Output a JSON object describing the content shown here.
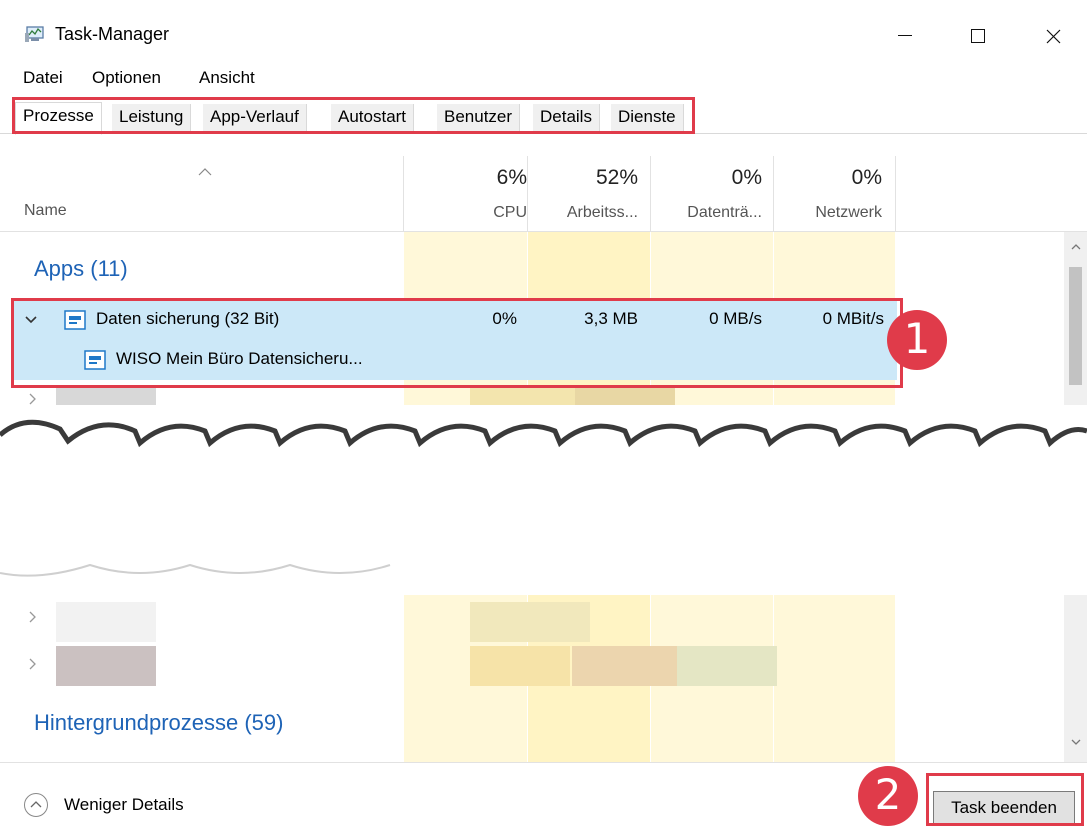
{
  "window": {
    "title": "Task-Manager",
    "minimize_glyph": "–",
    "maximize_glyph": "☐",
    "close_glyph": "✕"
  },
  "menu": {
    "items": [
      {
        "label": "Datei"
      },
      {
        "label": "Optionen"
      },
      {
        "label": "Ansicht"
      }
    ]
  },
  "tabs": [
    {
      "label": "Prozesse",
      "active": true
    },
    {
      "label": "Leistung"
    },
    {
      "label": "App-Verlauf"
    },
    {
      "label": "Autostart"
    },
    {
      "label": "Benutzer"
    },
    {
      "label": "Details"
    },
    {
      "label": "Dienste"
    }
  ],
  "columns": {
    "name": "Name",
    "cpu": {
      "pct": "6%",
      "label": "CPU"
    },
    "memory": {
      "pct": "52%",
      "label": "Arbeitss..."
    },
    "disk": {
      "pct": "0%",
      "label": "Datenträ..."
    },
    "network": {
      "pct": "0%",
      "label": "Netzwerk"
    }
  },
  "groups": {
    "apps": "Apps (11)",
    "background": "Hintergrundprozesse (59)"
  },
  "selected_process": {
    "name": "Daten sicherung (32 Bit)",
    "cpu": "0%",
    "memory": "3,3 MB",
    "disk": "0 MB/s",
    "network": "0 MBit/s",
    "child_name": "WISO Mein Büro Datensicheru..."
  },
  "annotations": {
    "badge_1": "1",
    "badge_2": "2"
  },
  "footer": {
    "fewer_details": "Weniger Details",
    "end_task": "Task beenden"
  },
  "colors": {
    "highlight_red": "#e03b4a",
    "group_blue": "#1e63b6",
    "selected_row": "#cce8f8",
    "heat_light": "#fff4c4"
  },
  "icons": {
    "app": "task-manager-icon",
    "expand": "chevron-down-icon",
    "collapsed": "chevron-right-icon",
    "sort": "sort-up-icon",
    "process": "app-window-icon",
    "fewer": "circle-chevron-up-icon"
  }
}
